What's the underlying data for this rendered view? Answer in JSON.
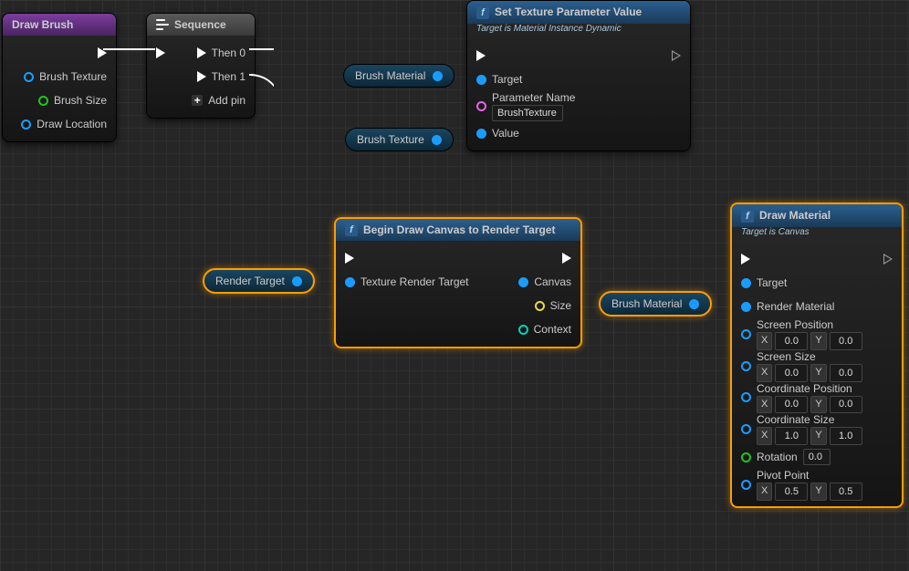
{
  "drawBrush": {
    "title": "Draw Brush",
    "pins": {
      "brushTexture": "Brush Texture",
      "brushSize": "Brush Size",
      "drawLocation": "Draw Location"
    }
  },
  "sequence": {
    "title": "Sequence",
    "then0": "Then 0",
    "then1": "Then 1",
    "addPin": "Add pin"
  },
  "setTextureParam": {
    "title": "Set Texture Parameter Value",
    "subtitle": "Target is Material Instance Dynamic",
    "target": "Target",
    "paramName": "Parameter Name",
    "paramValue": "BrushTexture",
    "value": "Value"
  },
  "beginDraw": {
    "title": "Begin Draw Canvas to Render Target",
    "trt": "Texture Render Target",
    "canvas": "Canvas",
    "size": "Size",
    "context": "Context"
  },
  "drawMaterial": {
    "title": "Draw Material",
    "subtitle": "Target is Canvas",
    "target": "Target",
    "renderMat": "Render Material",
    "screenPos": "Screen Position",
    "screenSize": "Screen Size",
    "coordPos": "Coordinate Position",
    "coordSize": "Coordinate Size",
    "rotation": "Rotation",
    "rotVal": "0.0",
    "pivot": "Pivot Point",
    "sp": {
      "x": "0.0",
      "y": "0.0"
    },
    "ss": {
      "x": "0.0",
      "y": "0.0"
    },
    "cp": {
      "x": "0.0",
      "y": "0.0"
    },
    "cs": {
      "x": "1.0",
      "y": "1.0"
    },
    "pp": {
      "x": "0.5",
      "y": "0.5"
    }
  },
  "vars": {
    "brushMaterial": "Brush Material",
    "brushTexture": "Brush Texture",
    "renderTarget": "Render Target",
    "brushMaterial2": "Brush Material"
  },
  "xyLabels": {
    "x": "X",
    "y": "Y"
  }
}
